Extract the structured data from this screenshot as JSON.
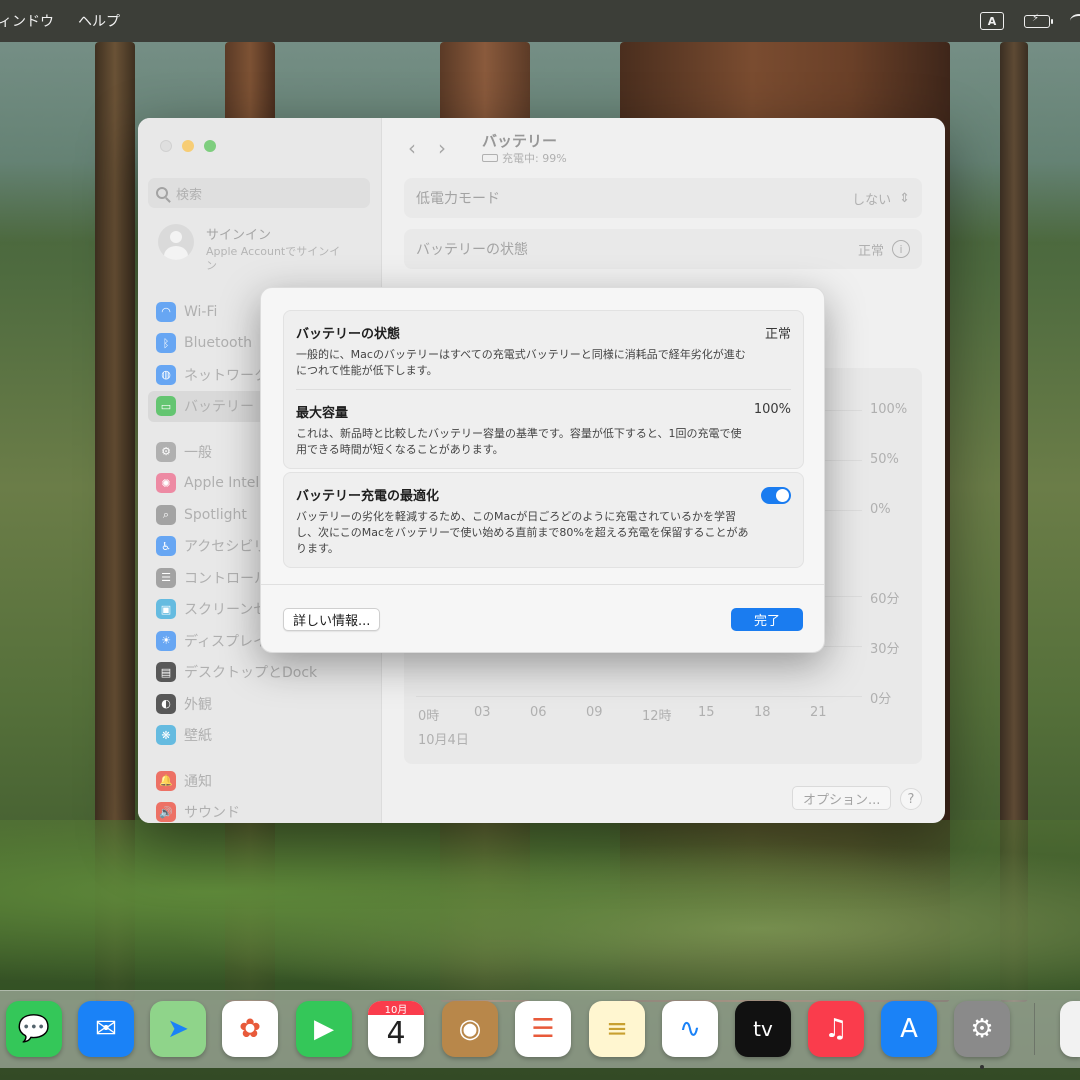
{
  "menubar": {
    "items": [
      "ィンドウ",
      "ヘルプ"
    ],
    "input_indicator": "A"
  },
  "settings": {
    "search_placeholder": "検索",
    "account": {
      "title": "サインイン",
      "subtitle": "Apple Accountでサインイン"
    },
    "sidebar": [
      {
        "label": "Wi-Fi",
        "icon": "wifi-icon",
        "color": "#3d8ef0"
      },
      {
        "label": "Bluetooth",
        "icon": "bluetooth-icon",
        "color": "#3d8ef0"
      },
      {
        "label": "ネットワーク",
        "icon": "globe-icon",
        "color": "#3d8ef0"
      },
      {
        "label": "バッテリー",
        "icon": "battery-icon",
        "color": "#39b54a"
      },
      {
        "label": "一般",
        "icon": "gear-icon",
        "color": "#9a9a9a"
      },
      {
        "label": "Apple Intelligence",
        "icon": "apple-intelligence-icon",
        "color": "#e86a8a"
      },
      {
        "label": "Spotlight",
        "icon": "magnifier-icon",
        "color": "#8a8a8a"
      },
      {
        "label": "アクセシビリティ",
        "icon": "accessibility-icon",
        "color": "#3d8ef0"
      },
      {
        "label": "コントロールセンター",
        "icon": "control-center-icon",
        "color": "#8a8a8a"
      },
      {
        "label": "スクリーンセーバ",
        "icon": "screensaver-icon",
        "color": "#3aa8d8"
      },
      {
        "label": "ディスプレイ",
        "icon": "display-icon",
        "color": "#3d8ef0"
      },
      {
        "label": "デスクトップとDock",
        "icon": "dock-icon",
        "color": "#2a2a2a"
      },
      {
        "label": "外観",
        "icon": "appearance-icon",
        "color": "#2a2a2a"
      },
      {
        "label": "壁紙",
        "icon": "wallpaper-icon",
        "color": "#3aa8d8"
      },
      {
        "label": "通知",
        "icon": "bell-icon",
        "color": "#e84a3a"
      },
      {
        "label": "サウンド",
        "icon": "speaker-icon",
        "color": "#e84a3a"
      }
    ],
    "page": {
      "title": "バッテリー",
      "subtitle": "充電中: 99%",
      "low_power": {
        "label": "低電力モード",
        "value": "しない"
      },
      "health": {
        "label": "バッテリーの状態",
        "value": "正常"
      },
      "chart_pct_labels": [
        "100%",
        "50%",
        "0%"
      ],
      "chart_min_labels": [
        "60分",
        "30分",
        "0分"
      ],
      "x_labels": [
        "0時",
        "03",
        "06",
        "09",
        "12時",
        "15",
        "18",
        "21"
      ],
      "date_label": "10月4日",
      "options_label": "オプション...",
      "help_label": "?"
    }
  },
  "sheet": {
    "health": {
      "title": "バッテリーの状態",
      "value": "正常",
      "desc": "一般的に、Macのバッテリーはすべての充電式バッテリーと同様に消耗品で経年劣化が進むにつれて性能が低下します。"
    },
    "capacity": {
      "title": "最大容量",
      "value": "100%",
      "desc": "これは、新品時と比較したバッテリー容量の基準です。容量が低下すると、1回の充電で使用できる時間が短くなることがあります。"
    },
    "optimize": {
      "title": "バッテリー充電の最適化",
      "enabled": true,
      "desc": "バッテリーの劣化を軽減するため、このMacが日ごろどのように充電されているかを学習し、次にこのMacをバッテリーで使い始める直前まで80%を超える充電を保留することがあります。"
    },
    "more_info_label": "詳しい情報...",
    "done_label": "完了"
  },
  "dock": {
    "calendar_month": "10月",
    "calendar_day": "4",
    "apps": [
      {
        "name": "messages-icon",
        "color": "#34c759",
        "glyph": "💬"
      },
      {
        "name": "mail-icon",
        "color": "#1a82f7",
        "glyph": "✉"
      },
      {
        "name": "maps-icon",
        "color": "#6fcf6a",
        "glyph": "➤"
      },
      {
        "name": "photos-icon",
        "color": "#ffffff",
        "glyph": "✿"
      },
      {
        "name": "facetime-icon",
        "color": "#34c759",
        "glyph": "▶"
      },
      {
        "name": "calendar-icon",
        "color": "#ffffff",
        "glyph": ""
      },
      {
        "name": "contacts-icon",
        "color": "#b8874a",
        "glyph": "◉"
      },
      {
        "name": "reminders-icon",
        "color": "#ffffff",
        "glyph": "☰"
      },
      {
        "name": "notes-icon",
        "color": "#ffd952",
        "glyph": "≡"
      },
      {
        "name": "freeform-icon",
        "color": "#ffffff",
        "glyph": "∿"
      },
      {
        "name": "apple-tv-icon",
        "color": "#111111",
        "glyph": "tv"
      },
      {
        "name": "music-icon",
        "color": "#fa3c4c",
        "glyph": "♫"
      },
      {
        "name": "app-store-icon",
        "color": "#1a82f7",
        "glyph": "A"
      },
      {
        "name": "system-settings-icon",
        "color": "#8a8a8a",
        "glyph": "⚙"
      }
    ]
  }
}
